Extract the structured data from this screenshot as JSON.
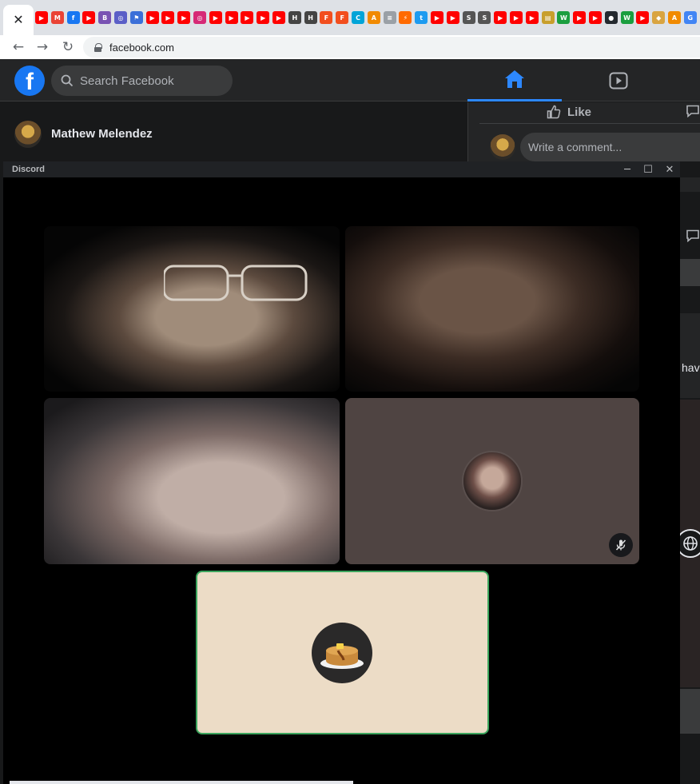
{
  "browser": {
    "active_tab_close_glyph": "✕",
    "address": "facebook.com",
    "bookmark_icons": [
      "youtube-icon",
      "gmail-icon",
      "facebook-icon",
      "youtube-icon",
      "bootstrap-icon",
      "globe-icon",
      "flag-icon",
      "youtube-icon",
      "youtube-icon",
      "youtube-icon",
      "instagram-icon",
      "youtube-icon",
      "youtube-icon",
      "youtube-icon",
      "youtube-icon",
      "youtube-icon",
      "hr-icon",
      "hr-icon",
      "figma-icon",
      "figma-icon",
      "c-icon",
      "app-icon",
      "page-icon",
      "bolt-icon",
      "twitter-icon",
      "youtube-icon",
      "youtube-icon",
      "s-icon",
      "s-icon",
      "youtube-icon",
      "youtube-icon",
      "youtube-icon",
      "news-icon",
      "w-icon",
      "youtube-icon",
      "youtube-icon",
      "github-icon",
      "w-icon",
      "youtube-icon",
      "food-icon",
      "app-icon",
      "google-icon"
    ]
  },
  "facebook": {
    "search_placeholder": "Search Facebook",
    "profile_name": "Mathew Melendez",
    "like_label": "Like",
    "comment_placeholder": "Write a comment...",
    "partial_text": "hav",
    "brand_color": "#1877f2"
  },
  "discord": {
    "title": "Discord",
    "window_controls": [
      "─",
      "☐",
      "✕"
    ],
    "speaking_border_color": "#3ba55d",
    "tiles": [
      {
        "kind": "camera"
      },
      {
        "kind": "camera"
      },
      {
        "kind": "camera"
      },
      {
        "kind": "avatar",
        "muted": true
      },
      {
        "kind": "avatar",
        "avatar_icon": "pancakes-icon",
        "speaking": true
      }
    ]
  }
}
